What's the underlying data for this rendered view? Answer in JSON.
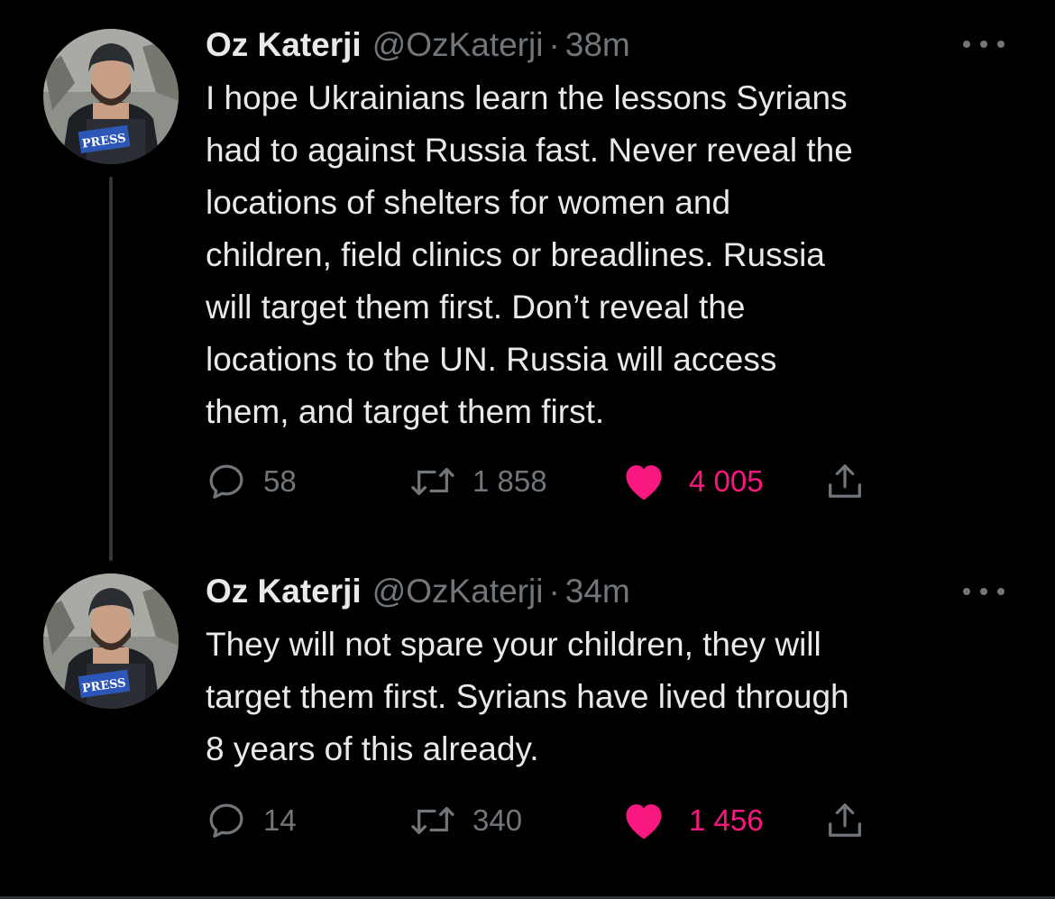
{
  "colors": {
    "background": "#000000",
    "text_primary": "#e7e9ea",
    "text_secondary": "#71767b",
    "like_active": "#f91880",
    "thread_line": "#333639"
  },
  "tweets": [
    {
      "author": {
        "name": "Oz Katerji",
        "handle": "@OzKaterji",
        "avatar_icon": "avatar-press-photographer",
        "vest_label": "PRESS"
      },
      "separator": "·",
      "time": "38m",
      "more_icon": "more-horizontal-icon",
      "text_lines": [
        "I hope Ukrainians learn the lessons Syrians",
        "had to against Russia fast. Never reveal the",
        "locations of shelters for women and",
        "children, field clinics or breadlines. Russia",
        "will target them first. Don’t reveal the",
        "locations to the UN. Russia will access",
        "them, and target them first."
      ],
      "actions": {
        "reply_icon": "reply-icon",
        "replies": "58",
        "retweet_icon": "retweet-icon",
        "retweets": "1 858",
        "like_icon": "heart-filled-icon",
        "likes": "4 005",
        "liked": true,
        "share_icon": "share-icon"
      }
    },
    {
      "author": {
        "name": "Oz Katerji",
        "handle": "@OzKaterji",
        "avatar_icon": "avatar-press-photographer",
        "vest_label": "PRESS"
      },
      "separator": "·",
      "time": "34m",
      "more_icon": "more-horizontal-icon",
      "text_lines": [
        "They will not spare your children, they will",
        "target them first. Syrians have lived through",
        "8 years of this already."
      ],
      "actions": {
        "reply_icon": "reply-icon",
        "replies": "14",
        "retweet_icon": "retweet-icon",
        "retweets": "340",
        "like_icon": "heart-filled-icon",
        "likes": "1 456",
        "liked": true,
        "share_icon": "share-icon"
      }
    }
  ]
}
